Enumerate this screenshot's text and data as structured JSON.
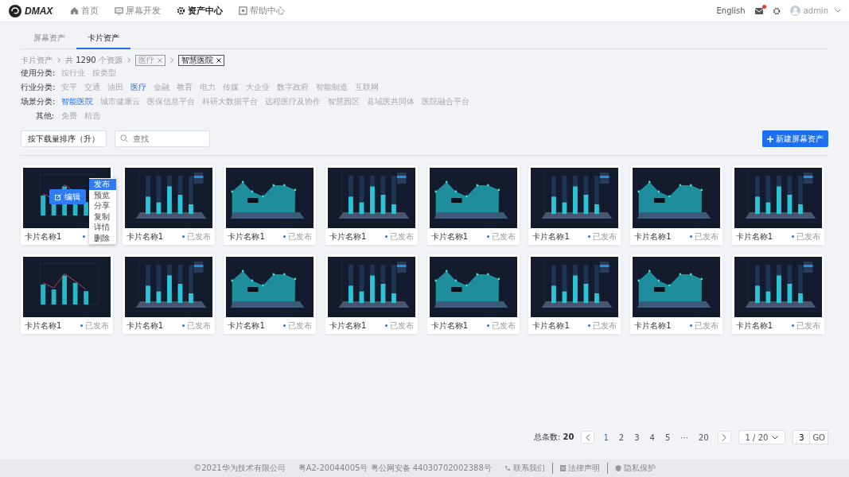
{
  "header": {
    "logo": "DMAX",
    "nav": [
      {
        "label": "首页",
        "selected": false
      },
      {
        "label": "屏幕开发",
        "selected": false
      },
      {
        "label": "资产中心",
        "selected": true
      },
      {
        "label": "帮助中心",
        "selected": false
      }
    ],
    "language": "English",
    "mail_badge": true,
    "user": "admin"
  },
  "tabs": [
    {
      "label": "屏幕资产",
      "selected": false
    },
    {
      "label": "卡片资产",
      "selected": true
    }
  ],
  "breadcrumb": {
    "root": "卡片资产",
    "count_prefix": "共",
    "count": "1290",
    "count_suffix": "个资源",
    "tags": [
      {
        "label": "医疗",
        "muted": true
      },
      {
        "label": "智慧医院",
        "muted": false
      }
    ]
  },
  "filters": [
    {
      "label": "使用分类:",
      "options": [
        {
          "label": "按行业",
          "selected": false
        },
        {
          "label": "按类型",
          "selected": false
        }
      ]
    },
    {
      "label": "行业分类:",
      "options": [
        {
          "label": "安平",
          "selected": false
        },
        {
          "label": "交通",
          "selected": false
        },
        {
          "label": "油田",
          "selected": false
        },
        {
          "label": "医疗",
          "selected": true
        },
        {
          "label": "金融",
          "selected": false
        },
        {
          "label": "教育",
          "selected": false
        },
        {
          "label": "电力",
          "selected": false
        },
        {
          "label": "传媒",
          "selected": false
        },
        {
          "label": "大企业",
          "selected": false
        },
        {
          "label": "数字政府",
          "selected": false
        },
        {
          "label": "智能制造",
          "selected": false
        },
        {
          "label": "互联网",
          "selected": false
        }
      ]
    },
    {
      "label": "场景分类:",
      "options": [
        {
          "label": "智能医院",
          "selected": true
        },
        {
          "label": "城市健康云",
          "selected": false
        },
        {
          "label": "医保信息平台",
          "selected": false
        },
        {
          "label": "科研大数据平台",
          "selected": false
        },
        {
          "label": "远程医疗及协作",
          "selected": false
        },
        {
          "label": "智慧园区",
          "selected": false
        },
        {
          "label": "县域医共同体",
          "selected": false
        },
        {
          "label": "医院融合平台",
          "selected": false
        }
      ]
    },
    {
      "label": "其他:",
      "options": [
        {
          "label": "免费",
          "selected": false
        },
        {
          "label": "精选",
          "selected": false
        }
      ]
    }
  ],
  "toolbar": {
    "sort": "按下载量排序（升）",
    "search_placeholder": "查找",
    "create_button": "新建屏幕资产"
  },
  "cards": [
    {
      "kind": "barline",
      "name": "卡片名称1",
      "hover": {
        "edit": "编辑",
        "menu": [
          {
            "label": "发布",
            "selected": true
          },
          {
            "label": "预览",
            "selected": false
          },
          {
            "label": "分享",
            "selected": false
          },
          {
            "label": "复制",
            "selected": false
          },
          {
            "label": "详情",
            "selected": false
          },
          {
            "label": "删除",
            "selected": false
          }
        ]
      }
    },
    {
      "kind": "bar3d",
      "name": "卡片名称1",
      "status": "已发布"
    },
    {
      "kind": "area",
      "name": "卡片名称1",
      "status": "已发布"
    },
    {
      "kind": "bar3d",
      "name": "卡片名称1",
      "status": "已发布"
    },
    {
      "kind": "area",
      "name": "卡片名称1",
      "status": "已发布"
    },
    {
      "kind": "bar3d",
      "name": "卡片名称1",
      "status": "已发布"
    },
    {
      "kind": "area",
      "name": "卡片名称1",
      "status": "已发布"
    },
    {
      "kind": "bar3d",
      "name": "卡片名称1",
      "status": "已发布"
    },
    {
      "kind": "barline",
      "name": "卡片名称1",
      "status": "已发布"
    },
    {
      "kind": "bar3d",
      "name": "卡片名称1",
      "status": "已发布"
    },
    {
      "kind": "area",
      "name": "卡片名称1",
      "status": "已发布"
    },
    {
      "kind": "bar3d",
      "name": "卡片名称1",
      "status": "已发布"
    },
    {
      "kind": "area",
      "name": "卡片名称1",
      "status": "已发布"
    },
    {
      "kind": "bar3d",
      "name": "卡片名称1",
      "status": "已发布"
    },
    {
      "kind": "area",
      "name": "卡片名称1",
      "status": "已发布"
    },
    {
      "kind": "bar3d",
      "name": "卡片名称1",
      "status": "已发布"
    }
  ],
  "pagination": {
    "total_label": "总条数:",
    "total": "20",
    "pages": [
      {
        "label": "1",
        "selected": true
      },
      {
        "label": "2",
        "selected": false
      },
      {
        "label": "3",
        "selected": false
      },
      {
        "label": "4",
        "selected": false
      },
      {
        "label": "5",
        "selected": false
      },
      {
        "label": "···",
        "selected": false
      },
      {
        "label": "20",
        "selected": false
      }
    ],
    "page_size": "1 / 20",
    "jump": "3",
    "go": "GO"
  },
  "footer": {
    "copyright": "©2021华为技术有限公司",
    "license": "粤A2-20044005号 粤公网安备 44030702002388号",
    "links": [
      "联系我们",
      "法律声明",
      "隐私保护"
    ]
  }
}
